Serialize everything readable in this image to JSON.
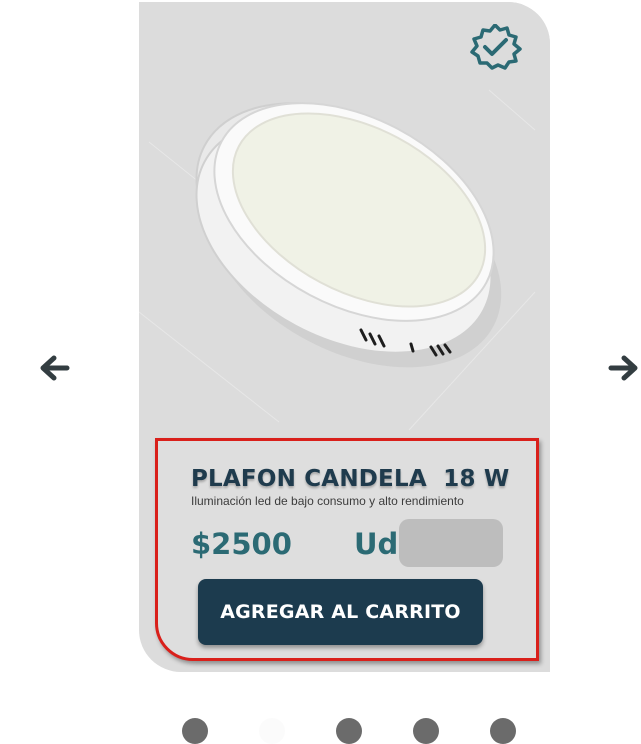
{
  "product": {
    "name": "PLAFON CANDELA  18 W",
    "description": "Iluminación led de bajo consumo y alto rendimiento",
    "price": "$2500",
    "unit_label": "Ud",
    "quantity_value": "",
    "add_to_cart_label": "AGREGAR AL CARRITO"
  },
  "icons": {
    "verified": "verified-badge-icon",
    "prev": "arrow-left-icon",
    "next": "arrow-right-icon"
  },
  "carousel": {
    "dot_count": 5,
    "active_index": 1
  },
  "colors": {
    "brand_dark": "#1c3b4e",
    "accent_teal": "#2b6a74",
    "highlight_border": "#d9201b",
    "card_bg": "#dcdcdc"
  }
}
